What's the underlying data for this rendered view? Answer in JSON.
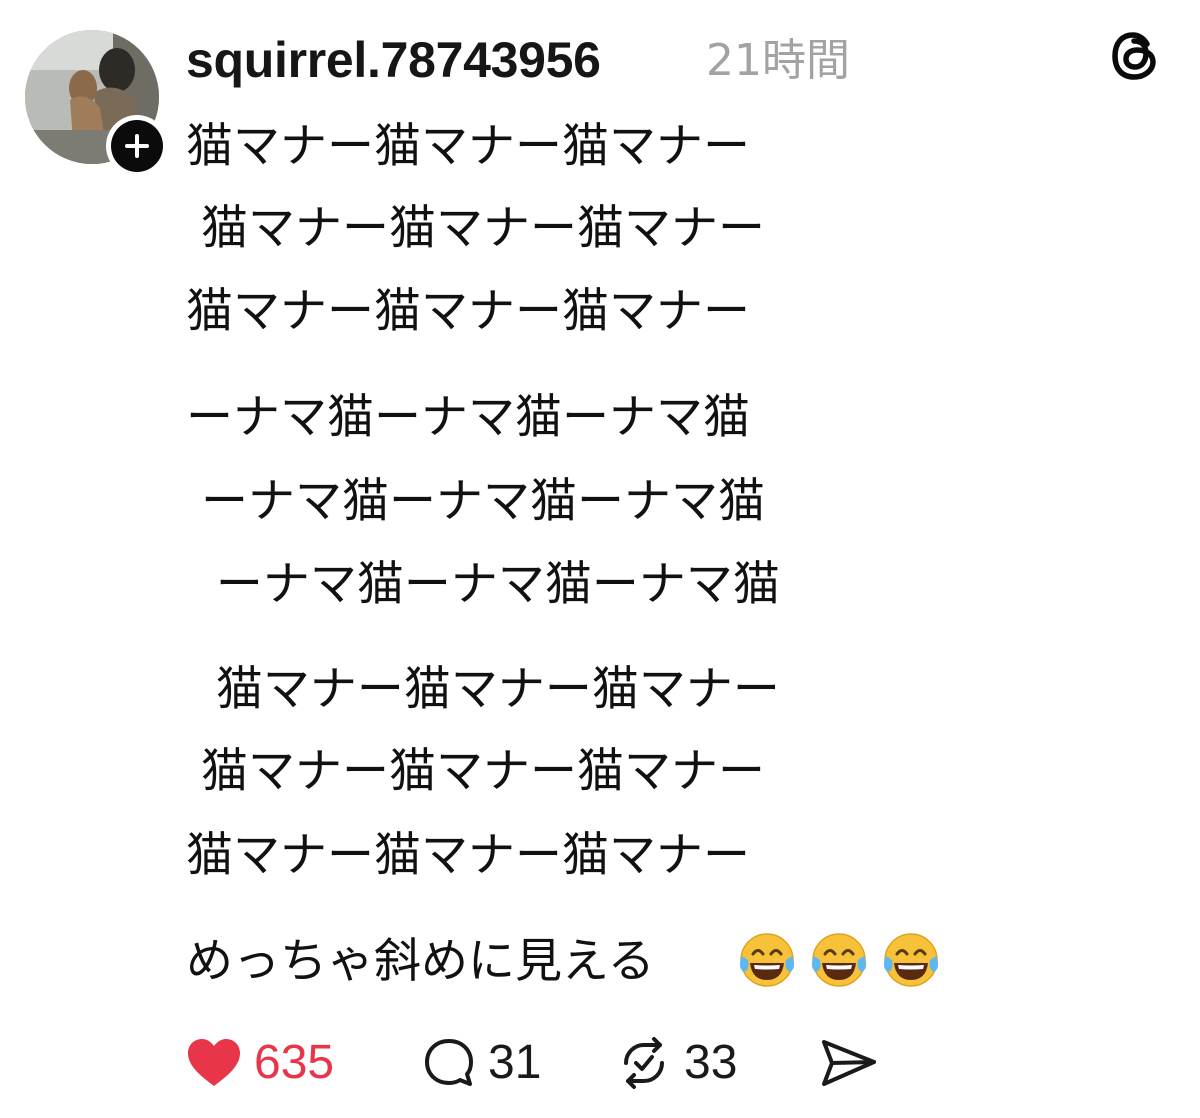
{
  "post": {
    "author": {
      "username": "squirrel.78743956",
      "avatar_icon": "profile-photo",
      "follow_icon": "plus-icon"
    },
    "timestamp": "21時間",
    "header_icon": "threads-logo-icon",
    "lines": [
      "猫マナー猫マナー猫マナー",
      " 猫マナー猫マナー猫マナー",
      "猫マナー猫マナー猫マナー",
      "ーナマ猫ーナマ猫ーナマ猫",
      " ーナマ猫ーナマ猫ーナマ猫",
      "  ーナマ猫ーナマ猫ーナマ猫",
      "  猫マナー猫マナー猫マナー",
      " 猫マナー猫マナー猫マナー",
      "猫マナー猫マナー猫マナー"
    ],
    "caption": "めっちゃ斜めに見える",
    "caption_emojis": [
      "face-with-tears-of-joy",
      "face-with-tears-of-joy",
      "face-with-tears-of-joy"
    ],
    "actions": {
      "like": {
        "count": "635",
        "icon": "heart-icon",
        "color": "#e8354a"
      },
      "reply": {
        "count": "31",
        "icon": "comment-icon"
      },
      "repost": {
        "count": "33",
        "icon": "repost-icon"
      },
      "share": {
        "icon": "send-icon"
      }
    }
  }
}
